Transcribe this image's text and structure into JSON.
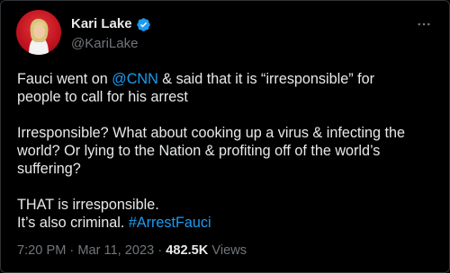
{
  "author": {
    "name": "Kari Lake",
    "handle": "@KariLake"
  },
  "menu": {
    "icon": "more-horizontal-icon"
  },
  "tweet": {
    "line1_pre": "Fauci went on ",
    "mention": "@CNN",
    "line1_post": " & said that it is “irresponsible” for",
    "line2": "people to call for his arrest",
    "para2_line1": "Irresponsible? What about cooking up a virus & infecting the",
    "para2_line2": "world? Or lying to the Nation & profiting off of the world’s",
    "para2_line3": "suffering?",
    "para3_line1": "THAT is irresponsible.",
    "para3_line2_pre": "It’s also criminal. ",
    "hashtag": "#ArrestFauci"
  },
  "meta": {
    "time": "7:20 PM",
    "separator1": " · ",
    "date": "Mar 11, 2023",
    "separator2": " · ",
    "views_count": "482.5K",
    "views_label": " Views"
  },
  "colors": {
    "background": "#000000",
    "text": "#e7e9ea",
    "secondary": "#71767b",
    "accent": "#1d9bf0",
    "badge": "#1d9bf0"
  }
}
